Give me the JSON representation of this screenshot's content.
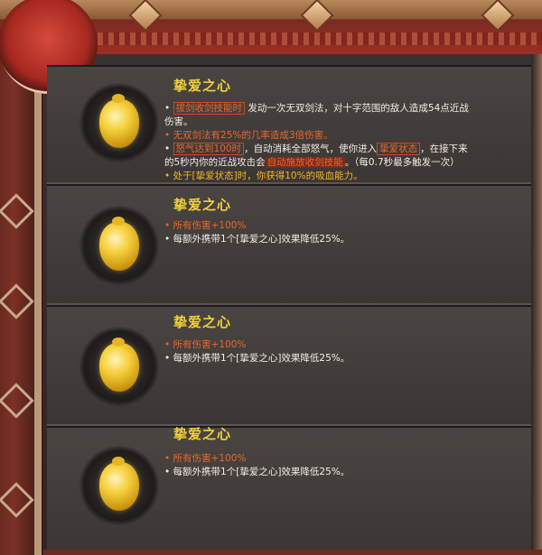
{
  "items": [
    {
      "title": "挚爱之心",
      "icon": "golden-heart-icon",
      "lines": [
        {
          "bullet": "•",
          "tag": "拔剑收剑技能时",
          "text": "发动一次无双剑法，对十字范围的敌人造成54点近战"
        },
        {
          "text": "伤害。"
        },
        {
          "bullet": "•",
          "text": "无双剑法有25%的几率造成3倍伤害。"
        },
        {
          "bullet": "•",
          "tag": "怒气达到100时",
          "text_a": "，自动消耗全部怒气，使你进入",
          "tag2": "挚爱状态",
          "text_b": "，在接下来"
        },
        {
          "text_a": "的5秒内你的近战攻击会",
          "hl": "自动施放收剑技能",
          "text_b": "。（每0.7秒最多触发一次）"
        },
        {
          "bullet": "•",
          "text": "处于[挚爱状态]时，你获得10%的吸血能力。"
        }
      ]
    },
    {
      "title": "挚爱之心",
      "icon": "golden-heart-icon",
      "lines": [
        {
          "bullet": "•",
          "text": "所有伤害+100%"
        },
        {
          "bullet": "•",
          "text": "每额外携带1个[挚爱之心]效果降低25%。"
        }
      ]
    },
    {
      "title": "挚爱之心",
      "icon": "golden-heart-icon",
      "lines": [
        {
          "bullet": "•",
          "text": "所有伤害+100%"
        },
        {
          "bullet": "•",
          "text": "每额外携带1个[挚爱之心]效果降低25%。"
        }
      ]
    },
    {
      "title": "挚爱之心",
      "icon": "golden-heart-icon",
      "lines": [
        {
          "bullet": "•",
          "text": "所有伤害+100%"
        },
        {
          "bullet": "•",
          "text": "每额外携带1个[挚爱之心]效果降低25%。"
        }
      ]
    }
  ],
  "colors": {
    "title": "#f0d03a",
    "accent": "#e9672c",
    "frame_red": "#9b2f26"
  }
}
